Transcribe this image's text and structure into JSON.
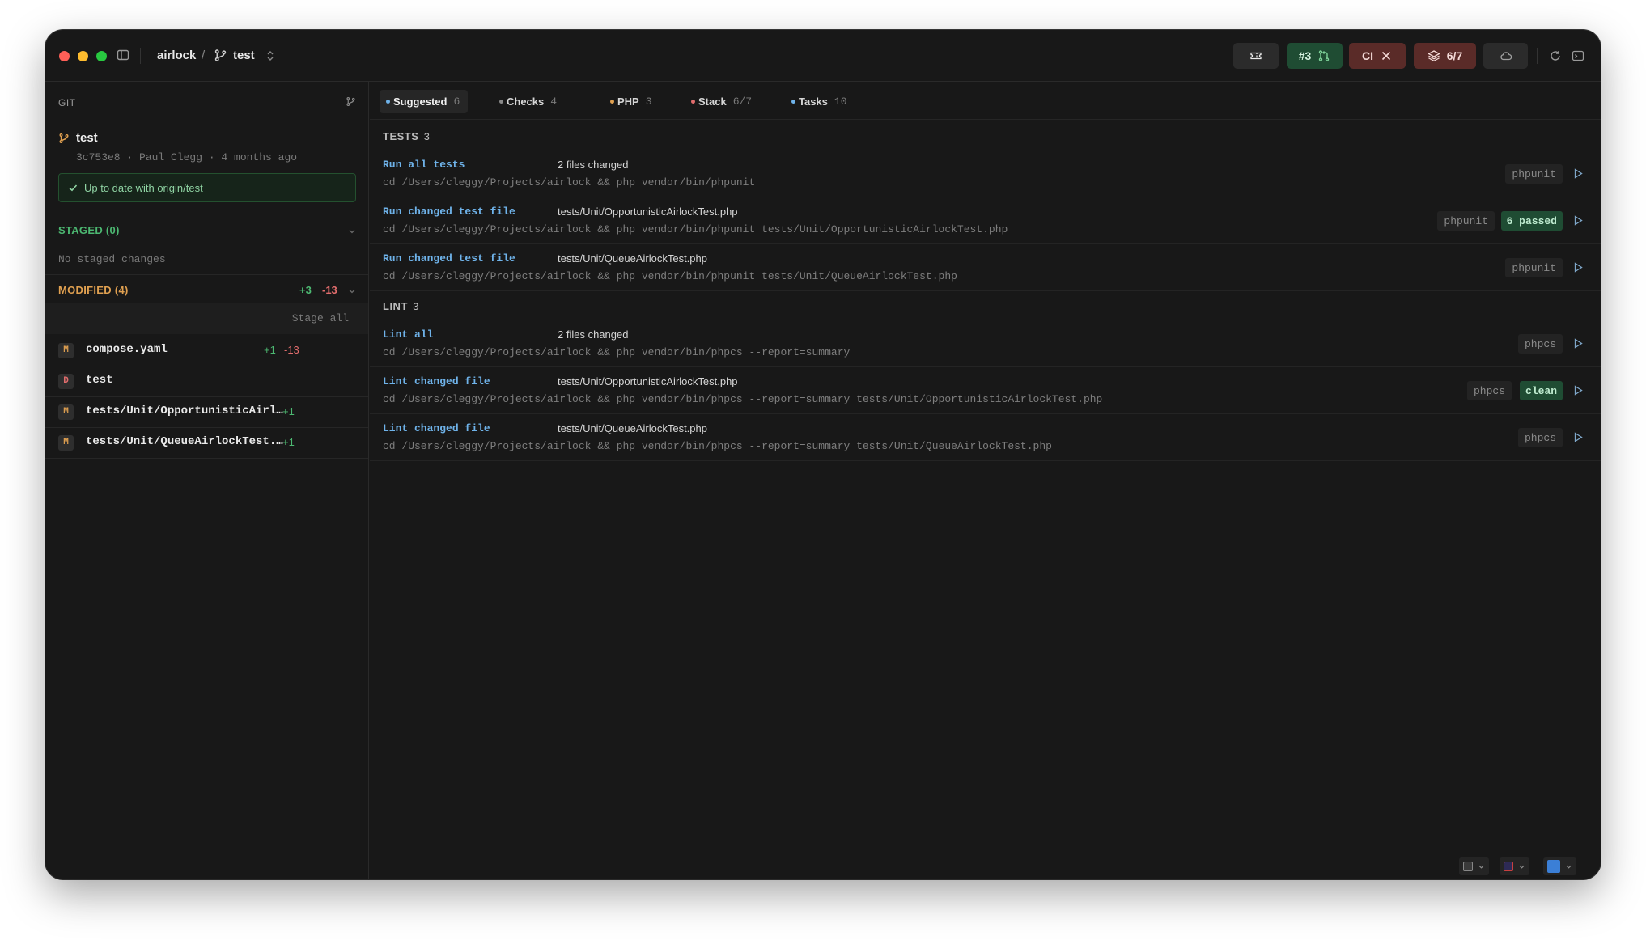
{
  "titlebar": {
    "repo": "airlock",
    "separator": "/",
    "branch": "test",
    "pr_label": "#3",
    "ci_label": "CI",
    "stack_label": "6/7"
  },
  "sidebar": {
    "header": "GIT",
    "commit": {
      "branch": "test",
      "meta": "3c753e8 · Paul Clegg · 4 months ago",
      "status": "Up to date with origin/test"
    },
    "staged": {
      "title": "STAGED (0)",
      "empty": "No staged changes"
    },
    "modified": {
      "title": "MODIFIED (4)",
      "additions": "+3",
      "deletions": "-13",
      "stage_all": "Stage all",
      "files": [
        {
          "status": "M",
          "name": "compose.yaml",
          "add": "+1",
          "del": "-13"
        },
        {
          "status": "D",
          "name": "test",
          "add": "",
          "del": ""
        },
        {
          "status": "M",
          "name": "tests/Unit/OpportunisticAirl…",
          "add": "+1",
          "del": ""
        },
        {
          "status": "M",
          "name": "tests/Unit/QueueAirlockTest.…",
          "add": "+1",
          "del": ""
        }
      ]
    }
  },
  "tabs": [
    {
      "label": "Suggested",
      "count": "6",
      "color": "#6fb3ea"
    },
    {
      "label": "Checks",
      "count": "4",
      "color": "#8a8a8a"
    },
    {
      "label": "PHP",
      "count": "3",
      "color": "#e0a050"
    },
    {
      "label": "Stack",
      "count": "6/7",
      "color": "#e06c6c"
    },
    {
      "label": "Tasks",
      "count": "10",
      "color": "#6fb3ea"
    }
  ],
  "groups": [
    {
      "title": "TESTS",
      "count": "3",
      "tasks": [
        {
          "name": "Run all tests",
          "files": "2 files changed",
          "cmd": "cd /Users/cleggy/Projects/airlock && php vendor/bin/phpunit",
          "tool": "phpunit",
          "result": ""
        },
        {
          "name": "Run changed test file",
          "files": "tests/Unit/OpportunisticAirlockTest.php",
          "cmd": "cd /Users/cleggy/Projects/airlock && php vendor/bin/phpunit tests/Unit/OpportunisticAirlockTest.php",
          "tool": "phpunit",
          "result": "6 passed"
        },
        {
          "name": "Run changed test file",
          "files": "tests/Unit/QueueAirlockTest.php",
          "cmd": "cd /Users/cleggy/Projects/airlock && php vendor/bin/phpunit tests/Unit/QueueAirlockTest.php",
          "tool": "phpunit",
          "result": ""
        }
      ]
    },
    {
      "title": "LINT",
      "count": "3",
      "tasks": [
        {
          "name": "Lint all",
          "files": "2 files changed",
          "cmd": "cd /Users/cleggy/Projects/airlock && php vendor/bin/phpcs --report=summary",
          "tool": "phpcs",
          "result": ""
        },
        {
          "name": "Lint changed file",
          "files": "tests/Unit/OpportunisticAirlockTest.php",
          "cmd": "cd /Users/cleggy/Projects/airlock && php vendor/bin/phpcs --report=summary tests/Unit/OpportunisticAirlockTest.php",
          "tool": "phpcs",
          "result": "clean"
        },
        {
          "name": "Lint changed file",
          "files": "tests/Unit/QueueAirlockTest.php",
          "cmd": "cd /Users/cleggy/Projects/airlock && php vendor/bin/phpcs --report=summary tests/Unit/QueueAirlockTest.php",
          "tool": "phpcs",
          "result": ""
        }
      ]
    }
  ]
}
